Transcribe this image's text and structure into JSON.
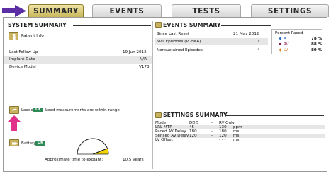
{
  "tabs": [
    {
      "label": "SUMMARY"
    },
    {
      "label": "EVENTS"
    },
    {
      "label": "TESTS"
    },
    {
      "label": "SETTINGS"
    }
  ],
  "system_summary": {
    "title": "SYSTEM SUMMARY",
    "patient_info_label": "Patient Info",
    "rows": [
      {
        "label": "Last Follow Up",
        "value": "19 Jun 2012"
      },
      {
        "label": "Implant Date",
        "value": "N/R"
      },
      {
        "label": "Device Model",
        "value": "V173"
      }
    ],
    "leads": {
      "label": "Leads",
      "status": "OK",
      "message": "Lead measurements are within range."
    },
    "battery": {
      "label": "Battery",
      "status": "OK",
      "explant_label": "Approximate time to explant:",
      "explant_value": "10.5 years",
      "gauge_fill": 0.12
    }
  },
  "events_summary": {
    "title": "EVENTS SUMMARY",
    "rows": [
      {
        "label": "Since Last Reset",
        "value": "21 May 2012"
      },
      {
        "label": "SVT Episodes (V <=A)",
        "value": "1"
      },
      {
        "label": "Nonsustained Episodes",
        "value": "4"
      }
    ],
    "percent_paced": {
      "title": "Percent Paced",
      "rows": [
        {
          "label": "A",
          "value": "78",
          "unit": "%",
          "color": "#1f5fbf"
        },
        {
          "label": "RV",
          "value": "88",
          "unit": "%",
          "color": "#8b1a4a"
        },
        {
          "label": "LV",
          "value": "89",
          "unit": "%",
          "color": "#d97a1a"
        }
      ]
    }
  },
  "settings_summary": {
    "title": "SETTINGS SUMMARY",
    "rows": [
      {
        "label": "Mode",
        "c1": "DDD",
        "sep": "-",
        "c2": "RV Only",
        "unit": ""
      },
      {
        "label": "LRL-MTR",
        "c1": "45",
        "sep": "-",
        "c2": "130",
        "unit": "ppm"
      },
      {
        "label": "Paced AV Delay",
        "c1": "180",
        "sep": "-",
        "c2": "180",
        "unit": "ms"
      },
      {
        "label": "Sensed AV Delay",
        "c1": "120",
        "sep": "-",
        "c2": "120",
        "unit": "ms"
      },
      {
        "label": "LV Offset",
        "c1": "",
        "sep": "",
        "c2": "- - -",
        "unit": "ms"
      }
    ]
  },
  "colors": {
    "accent": "#c9b65a",
    "ok_green": "#2e8b57",
    "arrow_purple": "#5b2ea6",
    "pink_arrow": "#e0308a",
    "gauge_yellow": "#f2d400"
  }
}
